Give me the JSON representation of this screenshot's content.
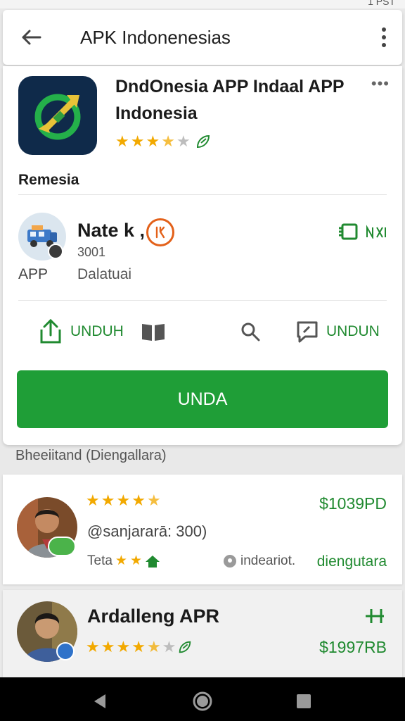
{
  "status_bar": {
    "time_right": "1 PST"
  },
  "app_bar": {
    "title": "APK Indonenesias"
  },
  "app": {
    "name": "DndOnesia APP Indaal APP Indonesia",
    "rating": 3.5,
    "section_label": "Remesia"
  },
  "developer": {
    "name": "Nate k ,",
    "count": "3001",
    "type": "APP",
    "description": "Dalatuai"
  },
  "actions": {
    "unduh_left": "UNDUH",
    "unduh_right": "UNDUN",
    "primary": "UNDA"
  },
  "list": {
    "header": "Bheeiitand (Diengallara)",
    "items": [
      {
        "handle": "@sanjararā: 300)",
        "rating": 4.5,
        "price": "$1039PD",
        "small_label": "Teta",
        "subtitle_link": "indeariot.",
        "right_link": "diengutara"
      },
      {
        "title": "Ardalleng APR",
        "rating": 4.5,
        "price": "$1997RB"
      }
    ]
  },
  "colors": {
    "accent_green": "#1f9e37",
    "star": "#f2a900",
    "badge_orange": "#e3611a"
  }
}
